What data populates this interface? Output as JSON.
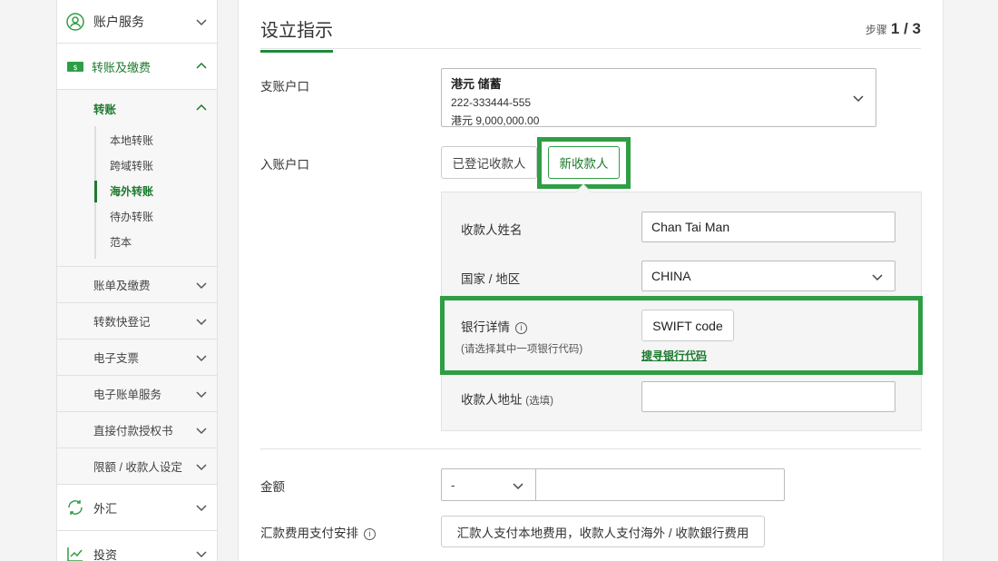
{
  "sidebar": {
    "account_services": "账户服务",
    "transfer_payment": "转账及缴费",
    "transfer": "转账",
    "transfer_items": [
      "本地转账",
      "跨域转账",
      "海外转账",
      "待办转账",
      "范本"
    ],
    "active_item": "海外转账",
    "rows": [
      "账单及缴费",
      "转数快登记",
      "电子支票",
      "电子账单服务",
      "直接付款授权书",
      "限额 / 收款人设定"
    ],
    "forex": "外汇",
    "invest": "投资"
  },
  "main": {
    "title": "设立指示",
    "step_label": "步骤",
    "step_value": "1 / 3",
    "debit_label": "支账户口",
    "debit_account": {
      "name": "港元 储蓄",
      "number": "222-333444-555",
      "balance": "港元 9,000,000.00"
    },
    "credit_label": "入账户口",
    "tab_registered": "已登记收款人",
    "tab_new": "新收款人",
    "payee_name_label": "收款人姓名",
    "payee_name_value": "Chan Tai Man",
    "country_label": "国家 / 地区",
    "country_value": "CHINA",
    "bank_details_label": "银行详情",
    "bank_details_note": "(请选择其中一项银行代码)",
    "swift_label": "SWIFT code",
    "search_bank_link": "搜寻银行代码",
    "payee_address_label": "收款人地址",
    "optional_tag": "(选填)",
    "amount_label": "金额",
    "currency_value": "-",
    "fee_label": "汇款费用支付安排",
    "fee_option": "汇款人支付本地费用，收款人支付海外 / 收款銀行费用"
  },
  "colors": {
    "brand_green": "#1c7a2e",
    "highlight_green": "#2e9e44"
  }
}
